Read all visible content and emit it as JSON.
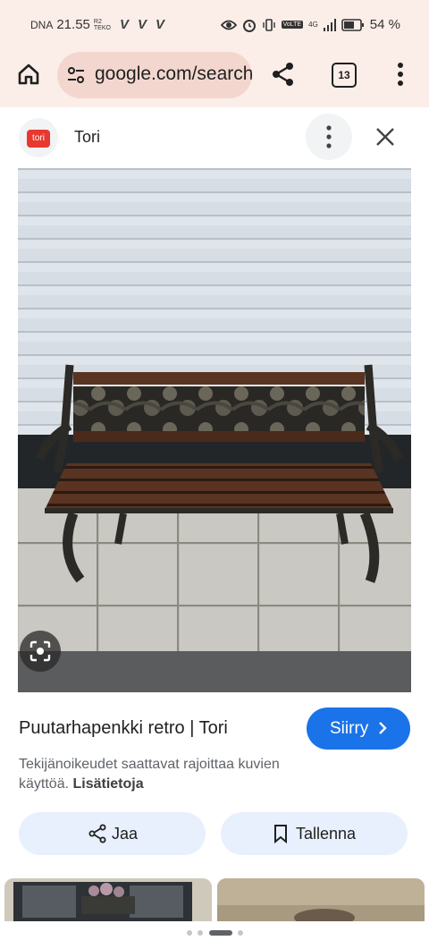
{
  "status_bar": {
    "carrier": "DNA",
    "time": "21.55",
    "net_top": "R2",
    "net_bottom": "TEKO",
    "volte": "VoLTE",
    "network_type": "4G",
    "battery": "54 %"
  },
  "browser": {
    "url": "google.com/search",
    "tab_count": "13"
  },
  "result": {
    "source_logo": "tori",
    "source_name": "Tori",
    "title": "Puutarhapenkki retro | Tori",
    "visit_label": "Siirry",
    "copyright_text": "Tekijänoikeudet saattavat rajoittaa kuvien käyttöä.",
    "copyright_link": "Lisätietoja",
    "share_label": "Jaa",
    "save_label": "Tallenna"
  },
  "colors": {
    "accent": "#1a73e8",
    "chrome_bg": "#fbeee9",
    "url_bg": "#f3d7cf",
    "button_bg": "#e8f0fe",
    "brand": "#e8382f"
  },
  "icons": {
    "home": "home-icon",
    "site_info": "tune-icon",
    "share": "share-icon",
    "tabs": "tabs-icon",
    "menu": "more-vert-icon",
    "close": "close-icon",
    "lens": "lens-icon",
    "bookmark": "bookmark-icon"
  },
  "carousel": {
    "page_count": 4,
    "active_page": 3
  }
}
